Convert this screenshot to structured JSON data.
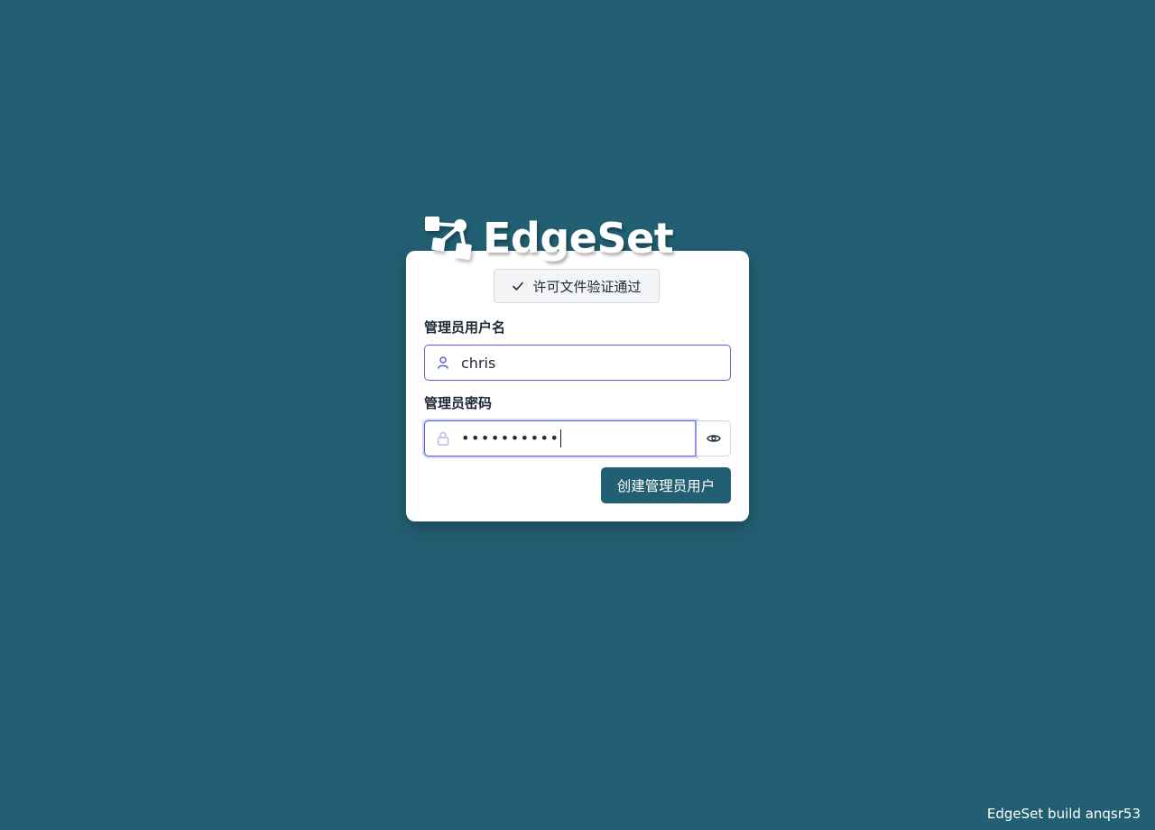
{
  "brand": {
    "name": "EdgeSet",
    "logo_icon": "graph-nodes-icon"
  },
  "license": {
    "status_text": "许可文件验证通过",
    "icon": "check-icon"
  },
  "form": {
    "username_label": "管理员用户名",
    "username_value": "chris",
    "username_icon": "user-icon",
    "password_label": "管理员密码",
    "password_masked": "••••••••••",
    "password_icon": "lock-icon",
    "toggle_visibility_icon": "eye-icon",
    "submit_label": "创建管理员用户"
  },
  "footer": {
    "build_text": "EdgeSet build anqsr53"
  },
  "colors": {
    "background": "#225f72",
    "primary_button": "#225f72",
    "focus_border": "#5b5fd6",
    "card": "#ffffff"
  }
}
